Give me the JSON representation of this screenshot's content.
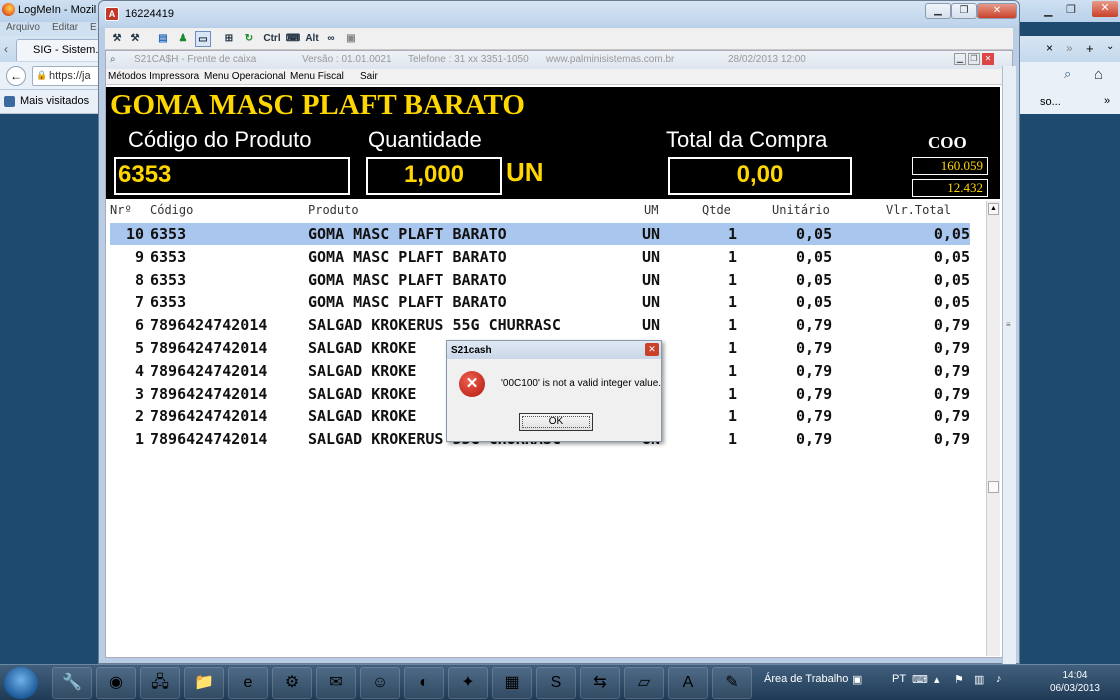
{
  "browser": {
    "title": "LogMeIn - Mozil",
    "menu": [
      "Arquivo",
      "Editar",
      "E"
    ],
    "tab_label": "SIG - Sistem...",
    "url": "https://ja",
    "bookmark": "Mais visitados",
    "right_tab_text": "so...",
    "close_tab": "×"
  },
  "lmi": {
    "title": "16224419",
    "toolbar": [
      "Ctrl",
      "Alt"
    ]
  },
  "app": {
    "title": "S21CA$H  -  Frente de caixa",
    "version": "Versão : 01.01.0021",
    "phone": "Telefone : 31 xx 3351-1050",
    "site": "www.palminisistemas.com.br",
    "datetime": "28/02/2013 12:00",
    "menu": [
      "Métodos Impressora",
      "Menu Operacional",
      "Menu Fiscal",
      "Sair"
    ],
    "product_name": "GOMA MASC PLAFT BARATO",
    "code_label": "Código do Produto",
    "code_value": "6353",
    "qty_label": "Quantidade",
    "qty_value": "1,000",
    "unit": "UN",
    "total_label": "Total da Compra",
    "total_value": "0,00",
    "coo_label": "COO",
    "coo_value1": "160.059",
    "coo_value2": "12.432",
    "columns": [
      "Nrº",
      "Código",
      "Produto",
      "UM",
      "Qtde",
      "Unitário",
      "Vlr.Total"
    ],
    "rows": [
      {
        "n": "10",
        "code": "6353",
        "prod": "GOMA MASC PLAFT BARATO",
        "um": "UN",
        "qtd": "1",
        "unit": "0,05",
        "total": "0,05",
        "selected": true
      },
      {
        "n": "9",
        "code": "6353",
        "prod": "GOMA MASC PLAFT BARATO",
        "um": "UN",
        "qtd": "1",
        "unit": "0,05",
        "total": "0,05"
      },
      {
        "n": "8",
        "code": "6353",
        "prod": "GOMA MASC PLAFT BARATO",
        "um": "UN",
        "qtd": "1",
        "unit": "0,05",
        "total": "0,05"
      },
      {
        "n": "7",
        "code": "6353",
        "prod": "GOMA MASC PLAFT BARATO",
        "um": "UN",
        "qtd": "1",
        "unit": "0,05",
        "total": "0,05"
      },
      {
        "n": "6",
        "code": "7896424742014",
        "prod": "SALGAD KROKERUS 55G CHURRASC",
        "um": "UN",
        "qtd": "1",
        "unit": "0,79",
        "total": "0,79"
      },
      {
        "n": "5",
        "code": "7896424742014",
        "prod": "SALGAD KROKE",
        "um": "UN",
        "qtd": "1",
        "unit": "0,79",
        "total": "0,79"
      },
      {
        "n": "4",
        "code": "7896424742014",
        "prod": "SALGAD KROKE",
        "um": "UN",
        "qtd": "1",
        "unit": "0,79",
        "total": "0,79"
      },
      {
        "n": "3",
        "code": "7896424742014",
        "prod": "SALGAD KROKE",
        "um": "UN",
        "qtd": "1",
        "unit": "0,79",
        "total": "0,79"
      },
      {
        "n": "2",
        "code": "7896424742014",
        "prod": "SALGAD KROKE",
        "um": "UN",
        "qtd": "1",
        "unit": "0,79",
        "total": "0,79"
      },
      {
        "n": "1",
        "code": "7896424742014",
        "prod": "SALGAD KROKERUS 55G CHURRASC",
        "um": "UN",
        "qtd": "1",
        "unit": "0,79",
        "total": "0,79"
      }
    ]
  },
  "dialog": {
    "title": "S21cash",
    "message": "'00C100' is not a valid integer value.",
    "ok": "OK"
  },
  "taskbar": {
    "desktop_label": "Área de Trabalho",
    "lang": "PT",
    "time": "14:04",
    "date": "06/03/2013"
  }
}
